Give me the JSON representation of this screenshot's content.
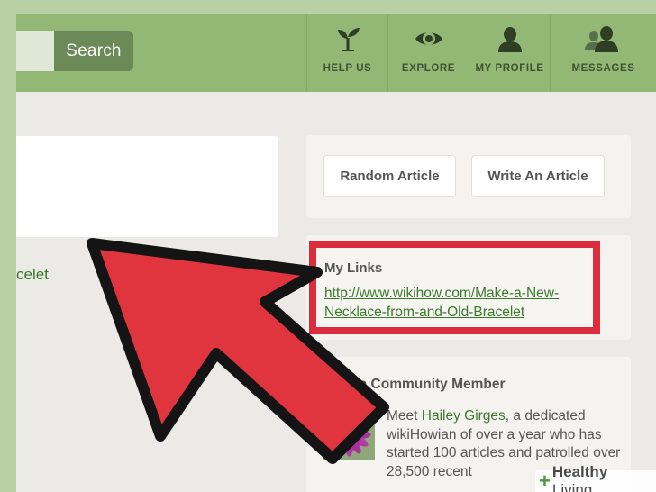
{
  "header": {
    "search_button": "Search",
    "nav": [
      {
        "label": "HELP US",
        "icon": "sprout-icon"
      },
      {
        "label": "EXPLORE",
        "icon": "eye-icon"
      },
      {
        "label": "MY PROFILE",
        "icon": "person-icon"
      },
      {
        "label": "MESSAGES",
        "icon": "people-icon"
      }
    ]
  },
  "left": {
    "link_fragment": "celet"
  },
  "sidebar": {
    "random_article": "Random Article",
    "write_article": "Write An Article",
    "my_links": {
      "title": "My Links",
      "url": "http://www.wikihow.com/Make-a-New-Necklace-from-and-Old-Bracelet"
    },
    "community": {
      "title": "Meet a Community Member",
      "text_prefix": "Meet ",
      "member_name": "Hailey Girges",
      "text_suffix": ", a dedicated wikiHowian of over a year who has started 100 articles and patrolled over 28,500 recent"
    }
  },
  "watermark": {
    "strong": "Healthy",
    "rest": " Living"
  },
  "colors": {
    "header_green": "#93b876",
    "search_button": "#6b8a58",
    "link_green": "#3b7a2c",
    "highlight_red": "#dc2d3f",
    "arrow_red": "#e0343f"
  }
}
